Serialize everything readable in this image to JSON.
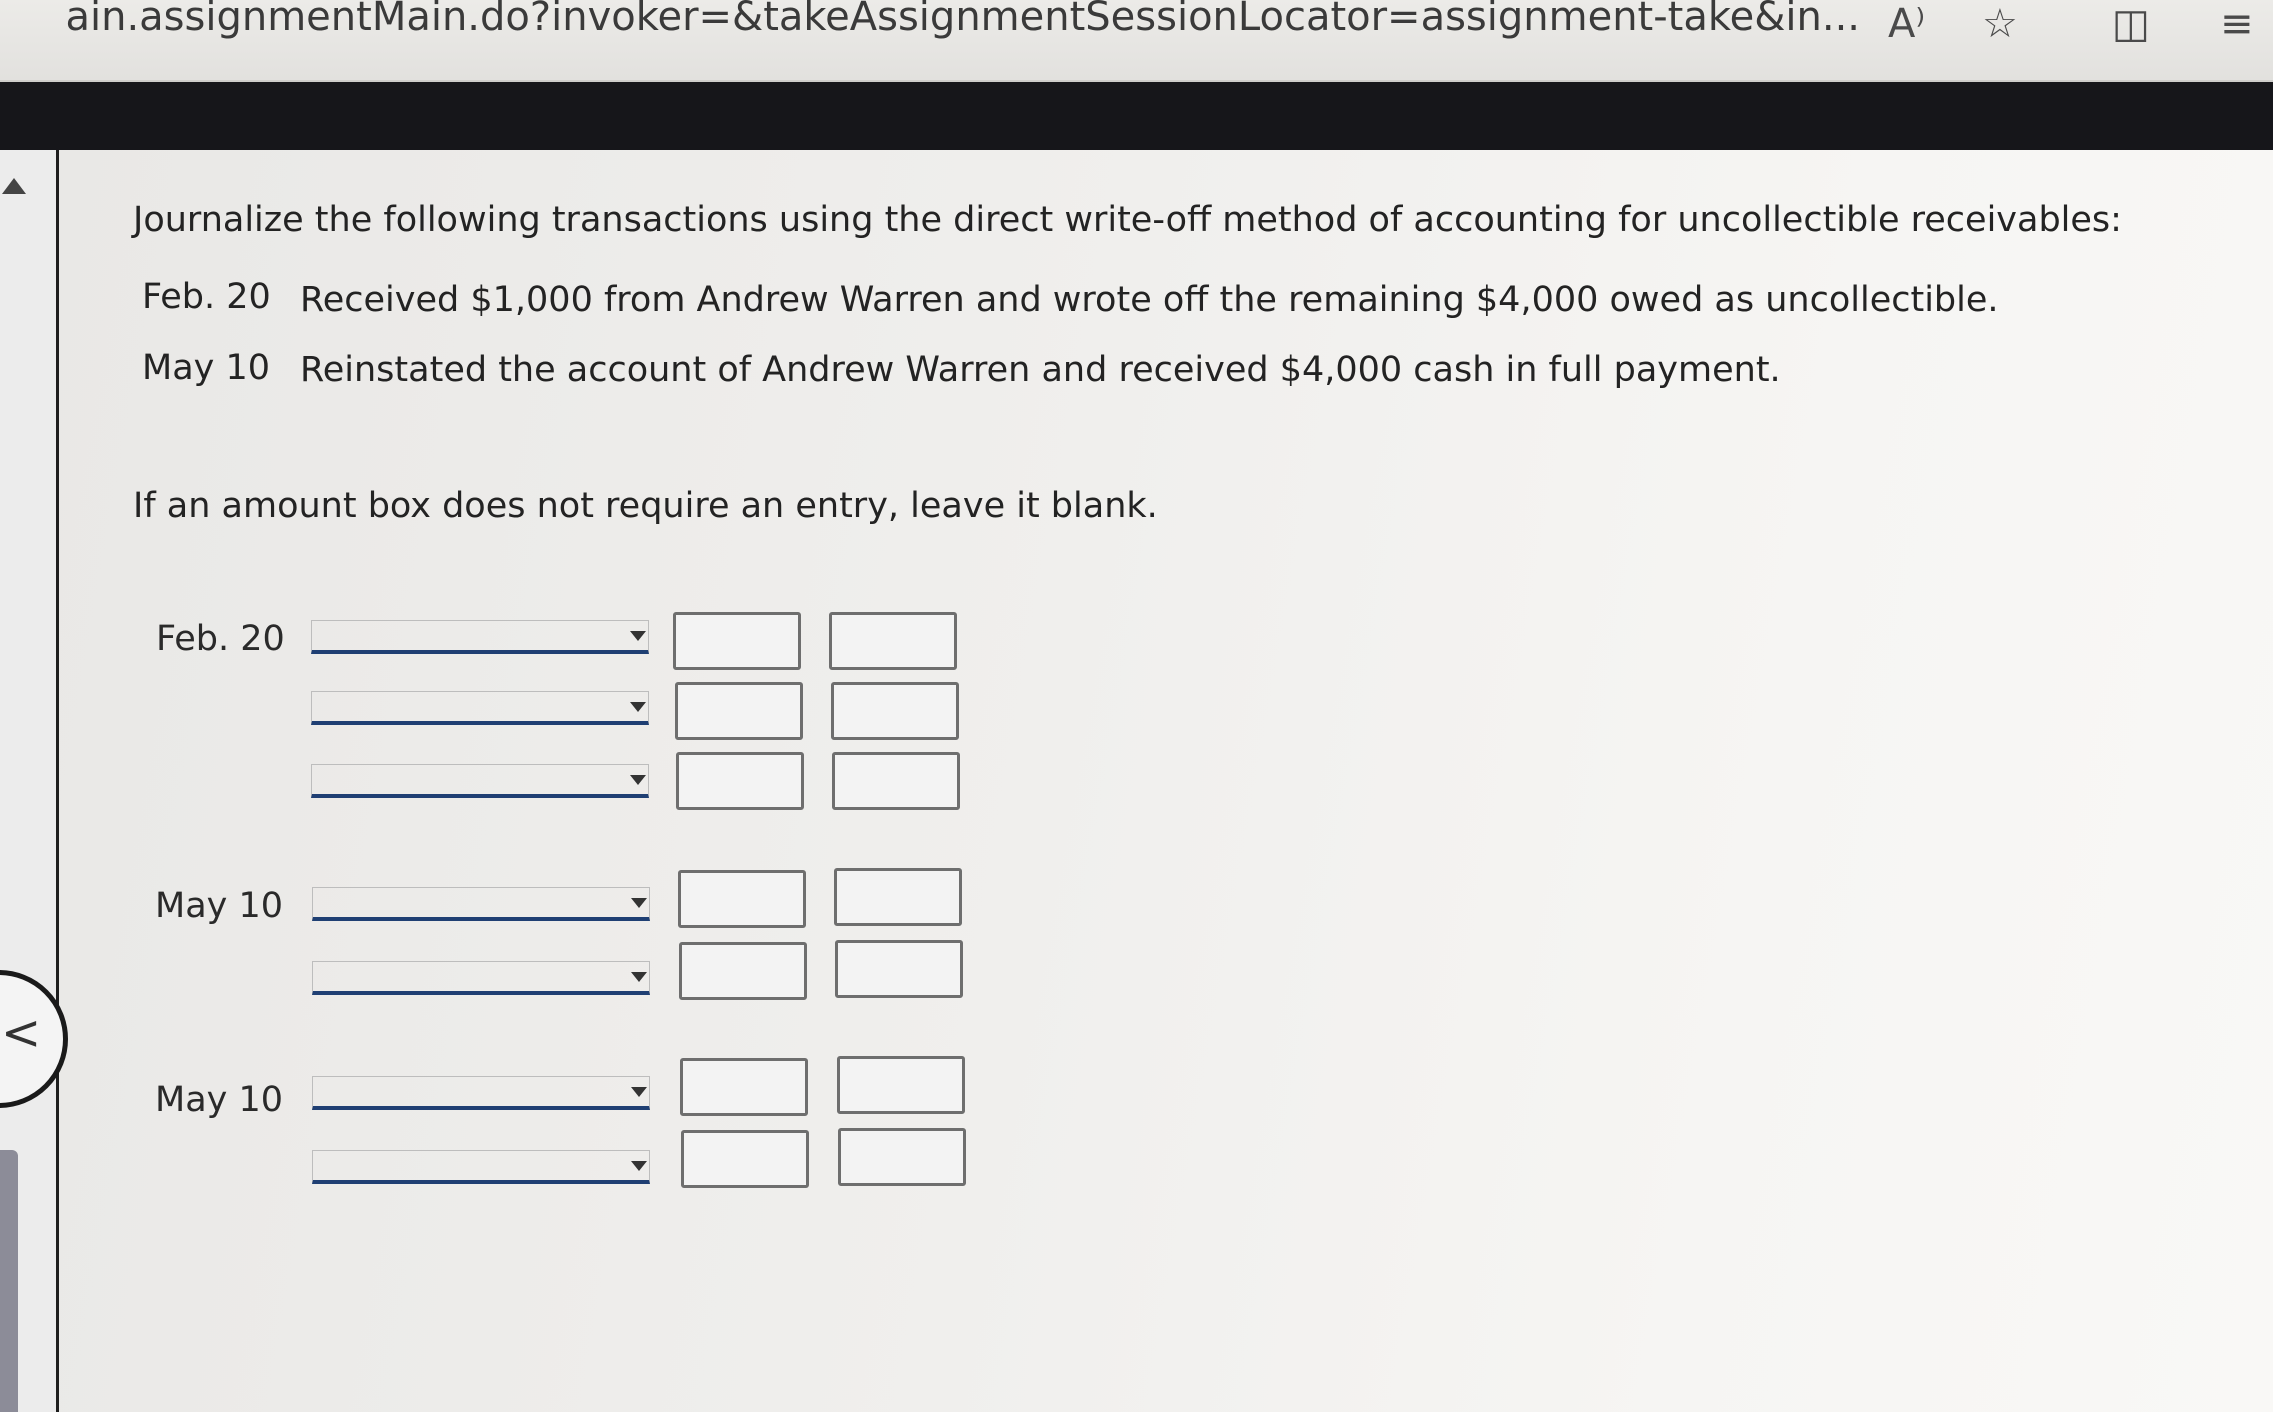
{
  "browser": {
    "url_text": "ain.assignmentMain.do?invoker=&takeAssignmentSessionLocator=assignment-take&in...",
    "read_aloud_icon": "A⁾",
    "favorite_icon": "☆",
    "split_icon": "◫",
    "favorites_bar_icon": "≡"
  },
  "nav": {
    "back_icon": "<"
  },
  "problem": {
    "instructions": "Journalize the following transactions using the direct write-off method of accounting for uncollectible receivables:",
    "transactions": [
      {
        "date": "Feb. 20",
        "description": "Received $1,000 from Andrew Warren and wrote off the remaining $4,000 owed as uncollectible."
      },
      {
        "date": "May 10",
        "description": "Reinstated the account of Andrew Warren and received $4,000 cash in full payment."
      }
    ],
    "note": "If an amount box does not require an entry, leave it blank."
  },
  "journal": {
    "entries": [
      {
        "date": "Feb. 20",
        "row_count": 3
      },
      {
        "date": "May 10",
        "row_count": 2
      },
      {
        "date": "May 10",
        "row_count": 2
      }
    ]
  }
}
